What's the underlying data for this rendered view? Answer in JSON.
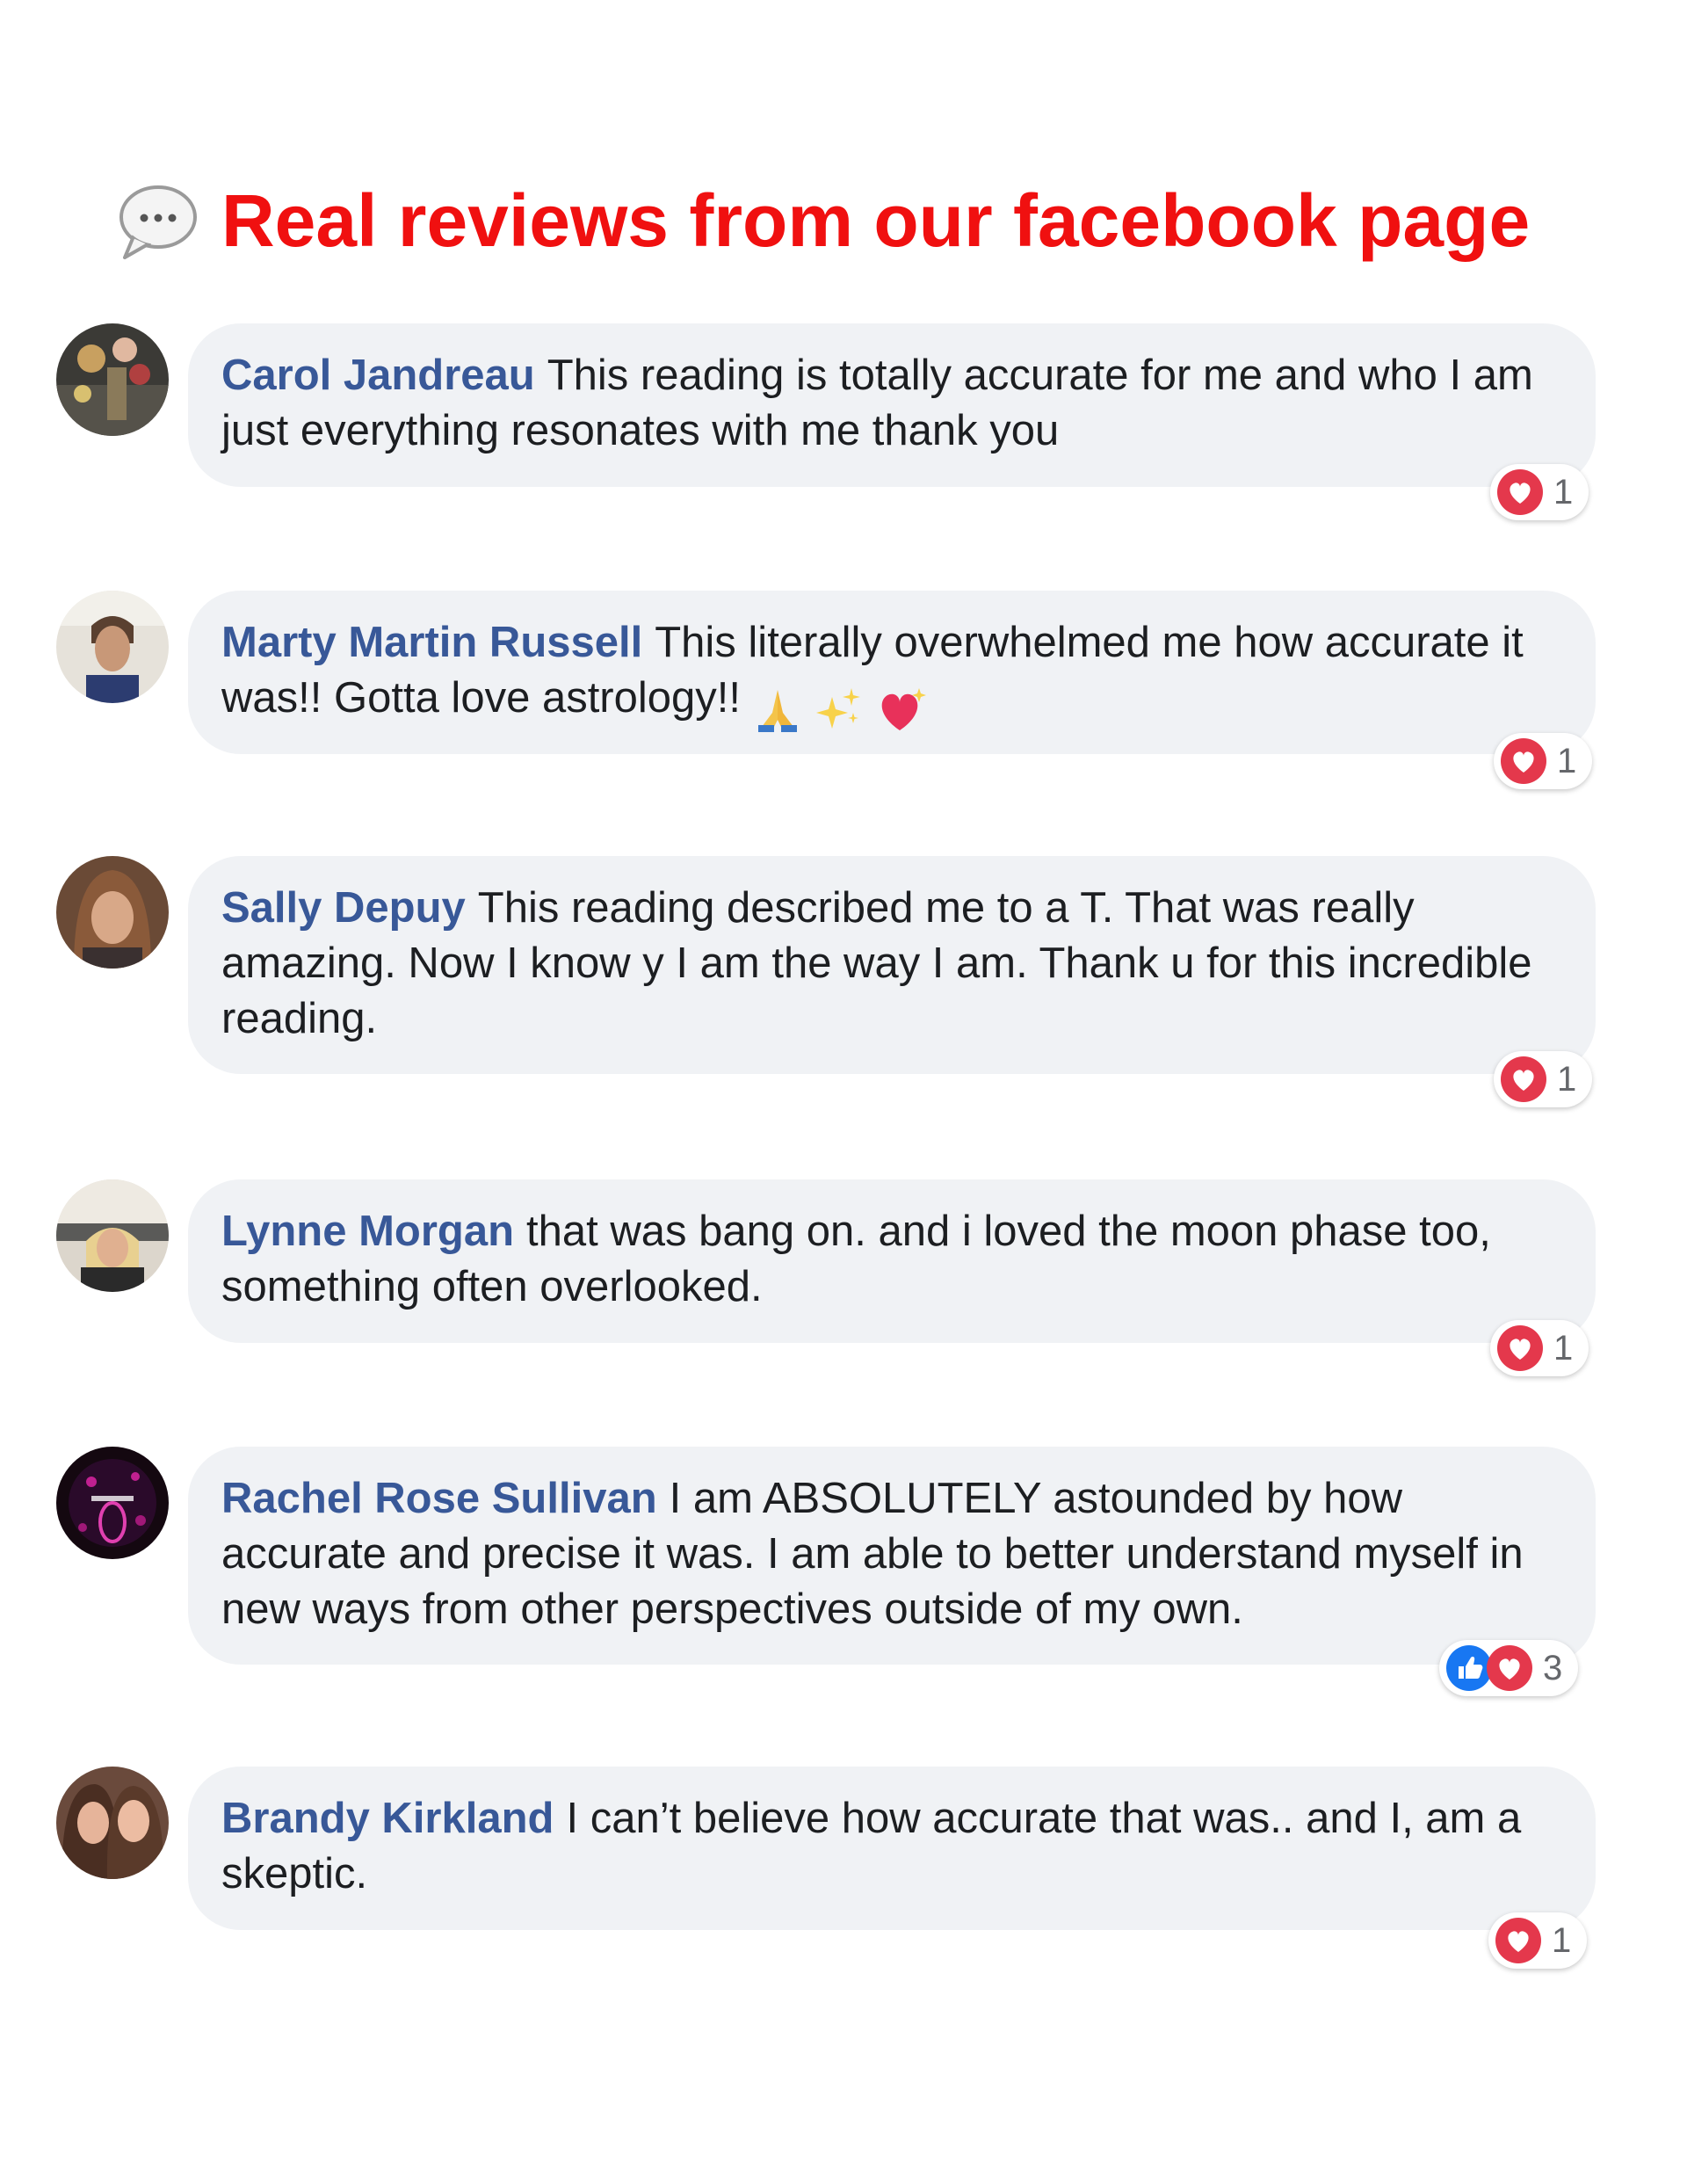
{
  "header": {
    "title": "Real reviews from our facebook page",
    "icon": "speech-bubble-icon"
  },
  "colors": {
    "title": "#f01010",
    "author": "#385898",
    "bubble": "#f0f2f5",
    "love": "#e4384c",
    "like": "#1877f2"
  },
  "reviews": [
    {
      "author": "Carol Jandreau",
      "text": "This reading is totally accurate for me and who I am just everything resonates with me thank you",
      "reactions": [
        "love"
      ],
      "reaction_count": "1"
    },
    {
      "author": "Marty Martin Russell",
      "text": "This literally overwhelmed me how accurate it was!! Gotta love astrology!!",
      "emojis": [
        "folded-hands-emoji",
        "sparkles-emoji",
        "sparkling-heart-emoji"
      ],
      "reactions": [
        "love"
      ],
      "reaction_count": "1"
    },
    {
      "author": "Sally Depuy",
      "text": "This reading described me to a T. That was really amazing. Now I know y I am the way I am. Thank u for this incredible reading.",
      "reactions": [
        "love"
      ],
      "reaction_count": "1"
    },
    {
      "author": "Lynne Morgan",
      "text": "that was bang on. and i loved the moon phase too, something often overlooked.",
      "reactions": [
        "love"
      ],
      "reaction_count": "1"
    },
    {
      "author": "Rachel Rose Sullivan",
      "text": "I am ABSOLUTELY astounded by how accurate and precise it was. I am able to better understand myself in new ways from other perspectives outside of my own.",
      "reactions": [
        "like",
        "love"
      ],
      "reaction_count": "3"
    },
    {
      "author": "Brandy Kirkland",
      "text": "I can’t believe how accurate that was.. and I, am a skeptic.",
      "reactions": [
        "love"
      ],
      "reaction_count": "1"
    }
  ]
}
